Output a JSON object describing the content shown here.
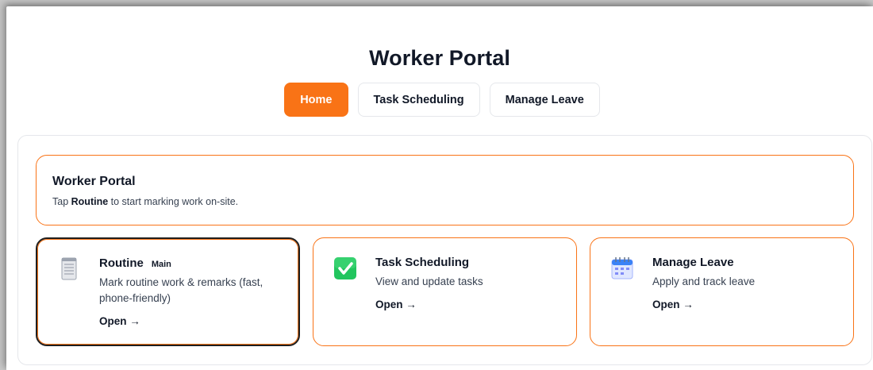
{
  "header": {
    "title": "Worker Portal",
    "tabs": [
      {
        "label": "Home"
      },
      {
        "label": "Task Scheduling"
      },
      {
        "label": "Manage Leave"
      }
    ]
  },
  "intro": {
    "title": "Worker Portal",
    "text_prefix": "Tap",
    "text_bold": "Routine",
    "text_suffix": "to start marking work on-site."
  },
  "cards": [
    {
      "title": "Routine",
      "badge": "Main",
      "desc": "Mark routine work & remarks (fast, phone-friendly)",
      "link": "Open →",
      "icon": "notepad-icon"
    },
    {
      "title": "Task Scheduling",
      "desc": "View and update tasks",
      "link": "Open →",
      "icon": "checkmark-icon"
    },
    {
      "title": "Manage Leave",
      "desc": "Apply and track leave",
      "link": "Open →",
      "icon": "calendar-icon"
    }
  ],
  "colors": {
    "accent": "#f97316",
    "text": "#111827"
  }
}
